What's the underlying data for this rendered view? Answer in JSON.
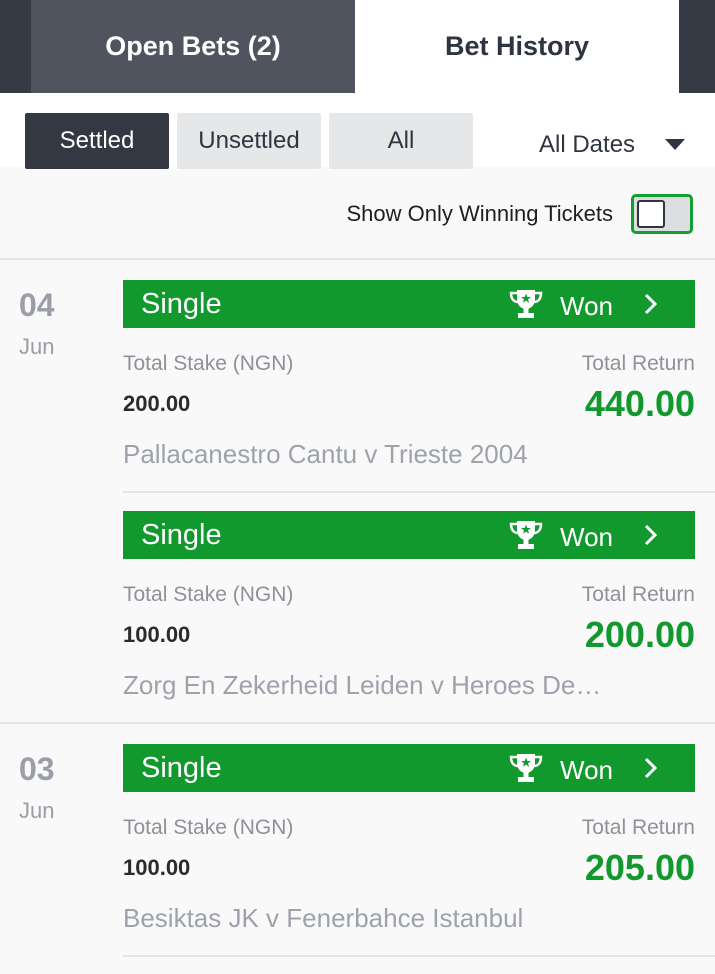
{
  "tabs": [
    {
      "label": "Open Bets (2)"
    },
    {
      "label": "Bet History"
    }
  ],
  "filters": {
    "buttons": [
      "Settled",
      "Unsettled",
      "All"
    ],
    "date_filter": "All Dates"
  },
  "winning_toggle": {
    "label": "Show Only Winning Tickets",
    "enabled": false
  },
  "colors": {
    "won_green": "#12992e",
    "dark": "#333842"
  },
  "groups": [
    {
      "day": "04",
      "month": "Jun",
      "bets": [
        {
          "type": "Single",
          "status": "Won",
          "stake_label": "Total Stake (NGN)",
          "stake": "200.00",
          "return_label": "Total Return",
          "return": "440.00",
          "event": "Pallacanestro Cantu v Trieste 2004"
        },
        {
          "type": "Single",
          "status": "Won",
          "stake_label": "Total Stake (NGN)",
          "stake": "100.00",
          "return_label": "Total Return",
          "return": "200.00",
          "event": "Zorg En Zekerheid Leiden v Heroes De…"
        }
      ]
    },
    {
      "day": "03",
      "month": "Jun",
      "bets": [
        {
          "type": "Single",
          "status": "Won",
          "stake_label": "Total Stake (NGN)",
          "stake": "100.00",
          "return_label": "Total Return",
          "return": "205.00",
          "event": "Besiktas JK v Fenerbahce Istanbul"
        }
      ]
    }
  ]
}
